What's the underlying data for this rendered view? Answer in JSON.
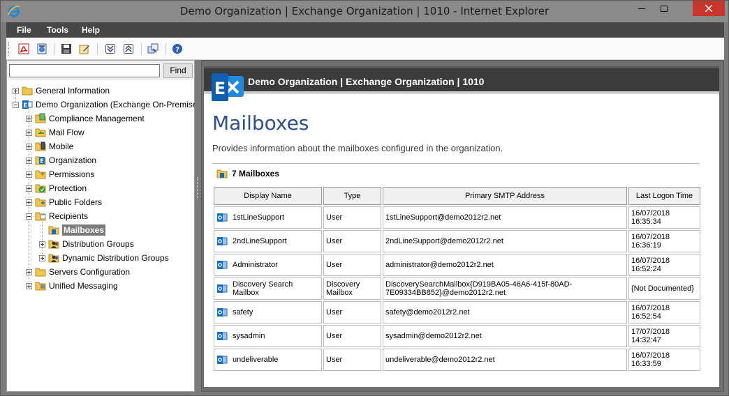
{
  "window": {
    "title": "Demo Organization | Exchange Organization | 1010 - Internet Explorer"
  },
  "menubar": {
    "items": [
      "File",
      "Tools",
      "Help"
    ]
  },
  "search": {
    "value": "",
    "find_label": "Find"
  },
  "tree": {
    "general_information": "General Information",
    "demo_org": "Demo Organization (Exchange On-Premises)",
    "compliance": "Compliance Management",
    "mail_flow": "Mail Flow",
    "mobile": "Mobile",
    "organization": "Organization",
    "permissions": "Permissions",
    "protection": "Protection",
    "public_folders": "Public Folders",
    "recipients": "Recipients",
    "mailboxes": "Mailboxes",
    "distribution_groups": "Distribution Groups",
    "dynamic_distribution_groups": "Dynamic Distribution Groups",
    "servers_configuration": "Servers Configuration",
    "unified_messaging": "Unified Messaging"
  },
  "document": {
    "header_title": "Demo Organization | Exchange Organization | 1010",
    "page_title": "Mailboxes",
    "description": "Provides information about the mailboxes configured in the organization.",
    "section_title": "7 Mailboxes",
    "columns": [
      "Display Name",
      "Type",
      "Primary SMTP Address",
      "Last Logon Time"
    ],
    "rows": [
      {
        "name": "1stLineSupport",
        "type": "User",
        "smtp": "1stLineSupport@demo2012r2.net",
        "logon_date": "16/07/2018",
        "logon_time": "16:35:34"
      },
      {
        "name": "2ndLineSupport",
        "type": "User",
        "smtp": "2ndLineSupport@demo2012r2.net",
        "logon_date": "16/07/2018",
        "logon_time": "16:36:19"
      },
      {
        "name": "Administrator",
        "type": "User",
        "smtp": "administrator@demo2012r2.net",
        "logon_date": "16/07/2018",
        "logon_time": "16:52:24"
      },
      {
        "name": "Discovery Search Mailbox",
        "type": "Discovery",
        "type2": "Mailbox",
        "smtp": "DiscoverySearchMailbox{D919BA05-46A6-415f-80AD-",
        "smtp2": "7E09334BB852}@demo2012r2.net",
        "logon_date": "{Not Documented}",
        "logon_time": ""
      },
      {
        "name": "safety",
        "type": "User",
        "smtp": "safety@demo2012r2.net",
        "logon_date": "16/07/2018",
        "logon_time": "16:52:54"
      },
      {
        "name": "sysadmin",
        "type": "User",
        "smtp": "sysadmin@demo2012r2.net",
        "logon_date": "17/07/2018",
        "logon_time": "14:32:47"
      },
      {
        "name": "undeliverable",
        "type": "User",
        "smtp": "undeliverable@demo2012r2.net",
        "logon_date": "16/07/2018",
        "logon_time": "16:33:59"
      }
    ]
  },
  "colors": {
    "title_blue": "#2e4f8c",
    "exchange_blue": "#0f6fc6",
    "header_dark": "#3b3b3b",
    "close_red": "#c7352b"
  }
}
